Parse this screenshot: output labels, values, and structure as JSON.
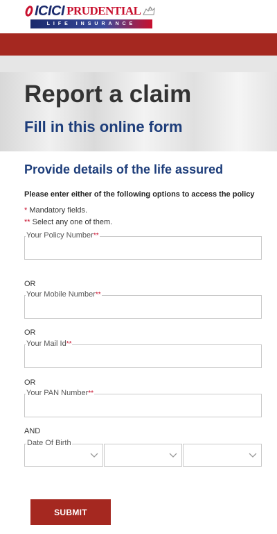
{
  "brand": {
    "name_part1": "ICICI",
    "name_part2": "PRUDENTIAL",
    "tagline": "LIFE INSURANCE",
    "primary_color": "#1a2a6c",
    "accent_color": "#c8102e"
  },
  "banner": {
    "title": "Report a claim",
    "subtitle": "Fill in this online form"
  },
  "form": {
    "section_title": "Provide details of the life assured",
    "instruction": "Please enter either of the following options to access the policy",
    "mandatory_note_marker": "*",
    "mandatory_note": " Mandatory fields.",
    "select_note_marker": "**",
    "select_note": " Select any one of them.",
    "fields": {
      "policy": {
        "label": "Your Policy Number",
        "marker": "**",
        "value": ""
      },
      "mobile": {
        "label": "Your Mobile Number",
        "marker": "**",
        "value": ""
      },
      "mail": {
        "label": "Your Mail Id",
        "marker": "**",
        "value": ""
      },
      "pan": {
        "label": "Your PAN Number",
        "marker": "**",
        "value": ""
      }
    },
    "or_label": "OR",
    "and_label": "AND",
    "dob_label": "Date Of Birth",
    "submit_label": "SUBMIT"
  },
  "colors": {
    "header_bar": "#a52820",
    "heading_blue": "#1d3d7a",
    "button_red": "#a52820"
  }
}
